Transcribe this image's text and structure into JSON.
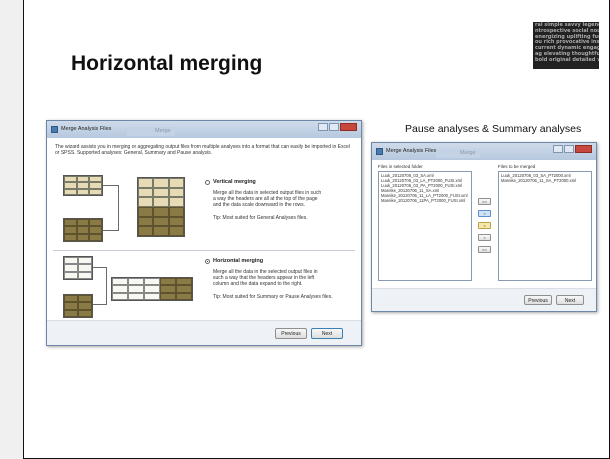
{
  "slide": {
    "title": "Horizontal merging",
    "caption": "Pause analyses & Summary analyses",
    "logo_lines": [
      "ral simple savvy legendary bright",
      "ntrospective social nourishing cla",
      "energizing uplifting funny shore",
      "ou rich provocative insightful ar",
      "current dynamic engaging lasti",
      "ag elevating thoughtful polished",
      "bold original detailed vivid play"
    ]
  },
  "window1": {
    "title": "Merge Analysis Files",
    "tab": "Merge",
    "intro": "The wizard assists you in merging or aggregating output files from multiple analyses into a format that can easily be imported in Excel or SPSS. Supported analyses: General, Summary and Pause analysis.",
    "vertical": {
      "title": "Vertical merging",
      "desc": "Merge all the data in selected output files in such a way the headers are all at the top of the page and the data scale downward in the rows.",
      "tip": "Tip: Most suited for General Analyses files."
    },
    "horizontal": {
      "title": "Horizontal merging",
      "desc": "Merge all the data in the selected output files in such a way that the headers appear in the left column and the data expand to the right.",
      "tip": "Tip: Most suited for Summary or Pause Analyses files."
    },
    "buttons": {
      "previous": "Previous",
      "next": "Next"
    }
  },
  "window2": {
    "title": "Merge Analysis Files",
    "tab": "Merge",
    "left_label": "Files in selected folder",
    "right_label": "Files to be merged",
    "left_files": [
      "Luuk_20120706_03_SA.xml",
      "Luuk_20120706_03_LA_PT2000_FUSI.xml",
      "Luuk_20120706_03_PA_PT2000_FUSI.xml",
      "Mareike_20120706_11_SA.xml",
      "Mareike_20120706_11_LA_PT2000_FUSI.xml",
      "Mareike_20120706_11PA_PT2000_FUSI.xml"
    ],
    "right_files": [
      "Luuk_20120706_03_SA_PT2000.xml",
      "Mareike_20120706_11_SA_PT2000.xml"
    ],
    "mid_buttons": [
      ">>",
      ">",
      "<",
      "<",
      "<<"
    ],
    "buttons": {
      "previous": "Previous",
      "next": "Next"
    }
  }
}
